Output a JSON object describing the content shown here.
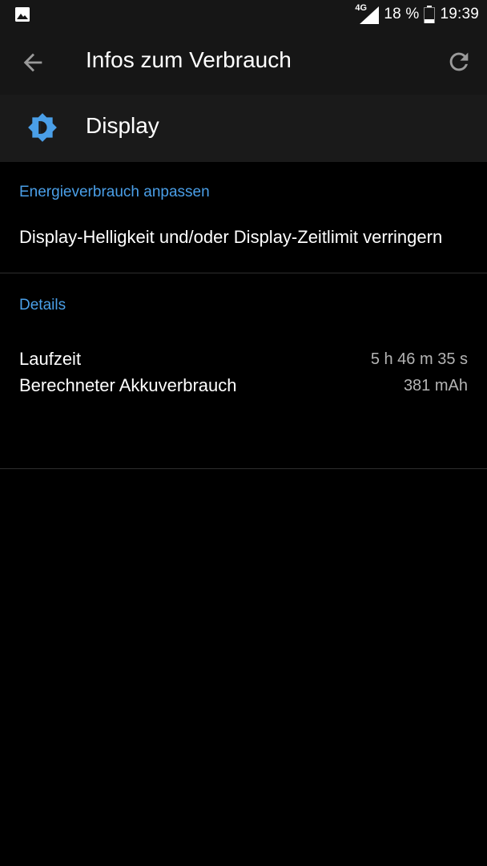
{
  "status_bar": {
    "notification_icon": "image-icon",
    "network": "4G",
    "battery_percent": "18 %",
    "time": "19:39"
  },
  "app_bar": {
    "back_icon": "arrow-back-icon",
    "title": "Infos zum Verbrauch",
    "refresh_icon": "refresh-icon"
  },
  "app_header": {
    "icon": "brightness-icon",
    "name": "Display"
  },
  "tips_section": {
    "title": "Energieverbrauch anpassen",
    "tip": "Display-Helligkeit und/oder Display-Zeitlimit verringern"
  },
  "details_section": {
    "title": "Details",
    "rows": [
      {
        "label": "Laufzeit",
        "value": "5 h 46 m 35 s"
      },
      {
        "label": "Berechneter Akkuverbrauch",
        "value": "381 mAh"
      }
    ]
  },
  "colors": {
    "accent": "#4a9fe8",
    "background": "#000000",
    "toolbar": "#161616"
  }
}
